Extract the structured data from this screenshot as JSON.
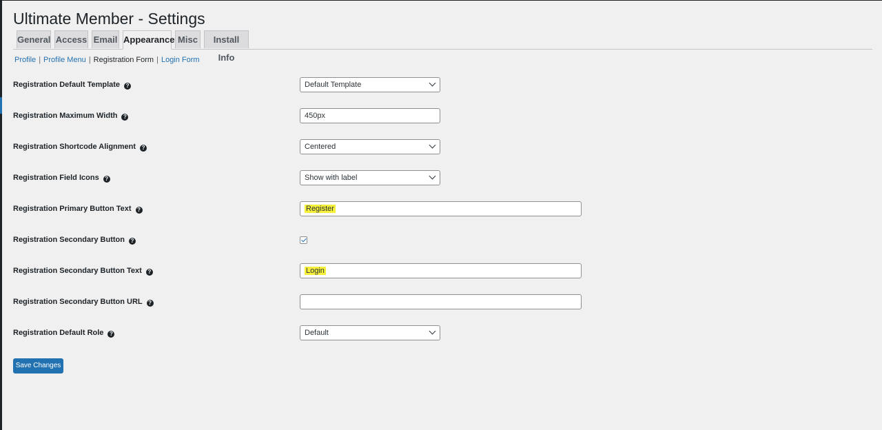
{
  "page": {
    "title": "Ultimate Member - Settings"
  },
  "tabs": [
    {
      "label": "General"
    },
    {
      "label": "Access"
    },
    {
      "label": "Email"
    },
    {
      "label": "Appearance",
      "active": true
    },
    {
      "label": "Misc"
    },
    {
      "label": "Install Info"
    }
  ],
  "subnav": {
    "items": [
      {
        "label": "Profile"
      },
      {
        "label": "Profile Menu"
      },
      {
        "label": "Registration Form",
        "current": true
      },
      {
        "label": "Login Form"
      }
    ],
    "separator": "|"
  },
  "fields": {
    "default_template": {
      "label": "Registration Default Template",
      "value": "Default Template"
    },
    "max_width": {
      "label": "Registration Maximum Width",
      "value": "450px"
    },
    "alignment": {
      "label": "Registration Shortcode Alignment",
      "value": "Centered"
    },
    "field_icons": {
      "label": "Registration Field Icons",
      "value": "Show with label"
    },
    "primary_btn_text": {
      "label": "Registration Primary Button Text",
      "value": "Register"
    },
    "secondary_btn": {
      "label": "Registration Secondary Button",
      "checked": true
    },
    "secondary_btn_text": {
      "label": "Registration Secondary Button Text",
      "value": "Login"
    },
    "secondary_btn_url": {
      "label": "Registration Secondary Button URL",
      "value": ""
    },
    "default_role": {
      "label": "Registration Default Role",
      "value": "Default"
    }
  },
  "help_icon_glyph": "?",
  "actions": {
    "save_label": "Save Changes"
  },
  "colors": {
    "accent": "#2271b1",
    "highlight": "#f6f03a",
    "background": "#f0f0f1"
  }
}
